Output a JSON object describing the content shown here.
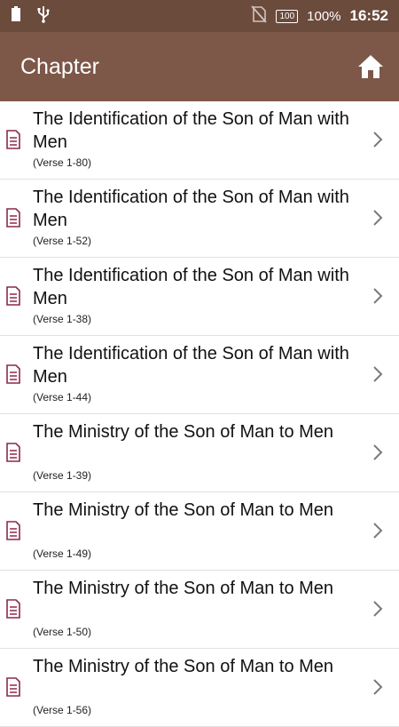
{
  "status_bar": {
    "battery_level": "100",
    "battery_percent": "100%",
    "time": "16:52"
  },
  "app_bar": {
    "title": "Chapter",
    "home_icon": "home-icon"
  },
  "colors": {
    "status_bar_bg": "#6b4b3c",
    "app_bar_bg": "#7d5748",
    "doc_icon": "#8b2a4a",
    "chevron": "#7a7a7a"
  },
  "chapters": [
    {
      "title": "The Identification of the Son of Man with Men",
      "verses": "(Verse 1-80)"
    },
    {
      "title": "The Identification of the Son of Man with Men",
      "verses": "(Verse 1-52)"
    },
    {
      "title": "The Identification of the Son of Man with Men",
      "verses": "(Verse 1-38)"
    },
    {
      "title": "The Identification of the Son of Man with Men",
      "verses": "(Verse 1-44)"
    },
    {
      "title": "The Ministry of the Son of Man to Men",
      "verses": "(Verse 1-39)"
    },
    {
      "title": "The Ministry of the Son of Man to Men",
      "verses": "(Verse 1-49)"
    },
    {
      "title": "The Ministry of the Son of Man to Men",
      "verses": "(Verse 1-50)"
    },
    {
      "title": "The Ministry of the Son of Man to Men",
      "verses": "(Verse 1-56)"
    }
  ]
}
